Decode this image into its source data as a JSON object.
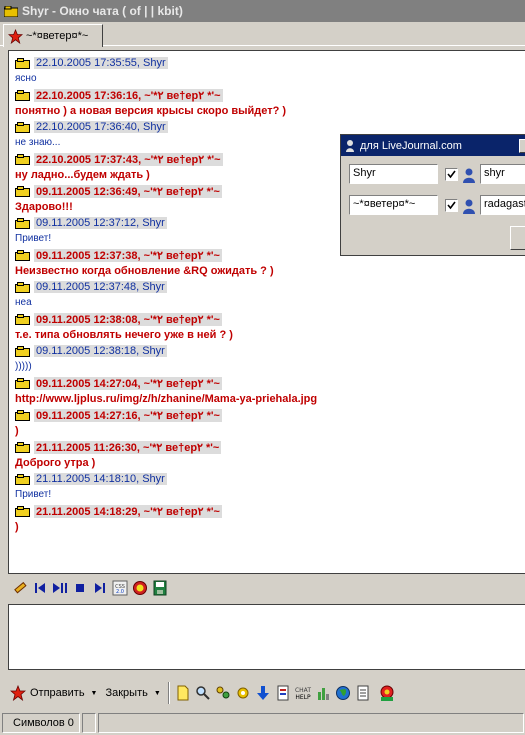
{
  "window": {
    "title": "Shyr - Окно чата    ( of  |   | kbit)"
  },
  "tab": {
    "label": "~*¤ветер¤*~"
  },
  "messages": [
    {
      "who": "me",
      "header": "22.10.2005 17:35:55, Shyr",
      "text": "ясно"
    },
    {
      "who": "other",
      "header": "22.10.2005 17:36:16, ~'*٢ ве†ер٢ *'~",
      "text": "понятно )   а новая версия  крысы  скоро выйдет? )"
    },
    {
      "who": "me",
      "header": "22.10.2005 17:36:40, Shyr",
      "text": "не знаю..."
    },
    {
      "who": "other",
      "header": "22.10.2005 17:37:43, ~'*٢ ве†ер٢ *'~",
      "text": "ну ладно...будем ждать )"
    },
    {
      "who": "other",
      "header": "09.11.2005 12:36:49, ~'*٢ ве†ер٢ *'~",
      "text": " Здарово!!!"
    },
    {
      "who": "me",
      "header": "09.11.2005 12:37:12, Shyr",
      "text": "Привет!"
    },
    {
      "who": "other",
      "header": "09.11.2005 12:37:38, ~'*٢ ве†ер٢ *'~",
      "text": "Неизвестно когда  обновление  &RQ  ожидать ? )"
    },
    {
      "who": "me",
      "header": "09.11.2005 12:37:48, Shyr",
      "text": "неа"
    },
    {
      "who": "other",
      "header": "09.11.2005 12:38:08, ~'*٢ ве†ер٢ *'~",
      "text": "т.е. типа обновлять нечего уже в ней ? )"
    },
    {
      "who": "me",
      "header": "09.11.2005 12:38:18, Shyr",
      "text": ")))))"
    },
    {
      "who": "other",
      "header": "09.11.2005 14:27:04, ~'*٢ ве†ер٢ *'~",
      "text": "http://www.ljplus.ru/img/z/h/zhanine/Mama-ya-priehala.jpg"
    },
    {
      "who": "other",
      "header": "09.11.2005 14:27:16, ~'*٢ ве†ер٢ *'~",
      "text": ")"
    },
    {
      "who": "other",
      "header": "21.11.2005 11:26:30, ~'*٢ ве†ер٢ *'~",
      "text": "Доброго утра )"
    },
    {
      "who": "me",
      "header": "21.11.2005 14:18:10, Shyr",
      "text": "Привет!"
    },
    {
      "who": "other",
      "header": "21.11.2005 14:18:29, ~'*٢ ве†ер٢ *'~",
      "text": " )"
    }
  ],
  "popup": {
    "title": "для LiveJournal.com",
    "row1_left": "Shyr",
    "row1_right": "shyr",
    "row2_left": "~*¤ветер¤*~",
    "row2_right": "radagast"
  },
  "toolbar2": {
    "send_label": "Отправить",
    "close_label": "Закрыть"
  },
  "status": {
    "chars_label": "Символов 0"
  },
  "colors": {
    "me_text": "#1030a0",
    "other_text": "#c00000",
    "title_bg": "#808080",
    "popup_title_bg": "#0a246a"
  }
}
